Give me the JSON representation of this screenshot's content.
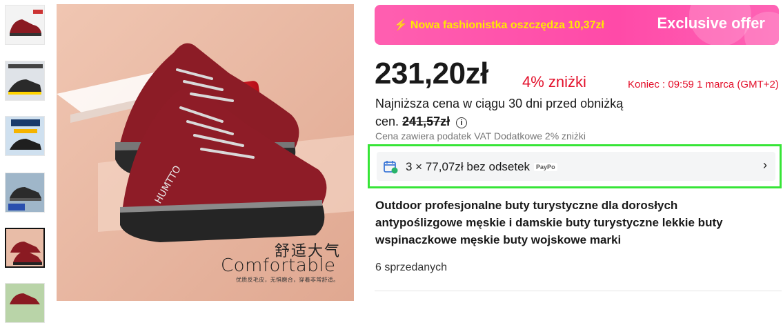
{
  "thumbnails": [
    {
      "name": "thumbnail-1",
      "selected": false
    },
    {
      "name": "thumbnail-2",
      "selected": false
    },
    {
      "name": "thumbnail-3",
      "selected": false
    },
    {
      "name": "thumbnail-4",
      "selected": false
    },
    {
      "name": "thumbnail-5",
      "selected": true
    },
    {
      "name": "thumbnail-6",
      "selected": false
    }
  ],
  "main_image": {
    "caption_cn": "舒适大气",
    "caption_en": "Comfortable",
    "caption_sub": "优质反毛皮，无惧磨合，穿着非常舒适。",
    "shoe_brand": "HUMTTO"
  },
  "banner": {
    "promo": "Nowa fashionistka oszczędza 10,37zł",
    "exclusive": "Exclusive offer"
  },
  "price": {
    "current": "231,20zł",
    "discount": "4% zniżki",
    "ends": "Koniec :  09:59 1 marca (GMT+2)",
    "lowest_prefix": "Najniższa cena w ciągu 30 dni przed obniżką cen.",
    "lowest_value": "241,57zł",
    "vat_note": "Cena zawiera podatek VAT Dodatkowe 2% zniżki"
  },
  "installment": {
    "text": "3 × 77,07zł bez odsetek",
    "provider": "PayPo"
  },
  "product": {
    "title": "Outdoor profesjonalne buty turystyczne dla dorosłych antypoślizgowe męskie i damskie buty turystyczne lekkie buty wspinaczkowe męskie buty wojskowe marki",
    "sold": "6 sprzedanych"
  },
  "colors": {
    "accent_red": "#e3102b",
    "banner_pink": "#ff4aa8",
    "highlight_green": "#36e536"
  }
}
